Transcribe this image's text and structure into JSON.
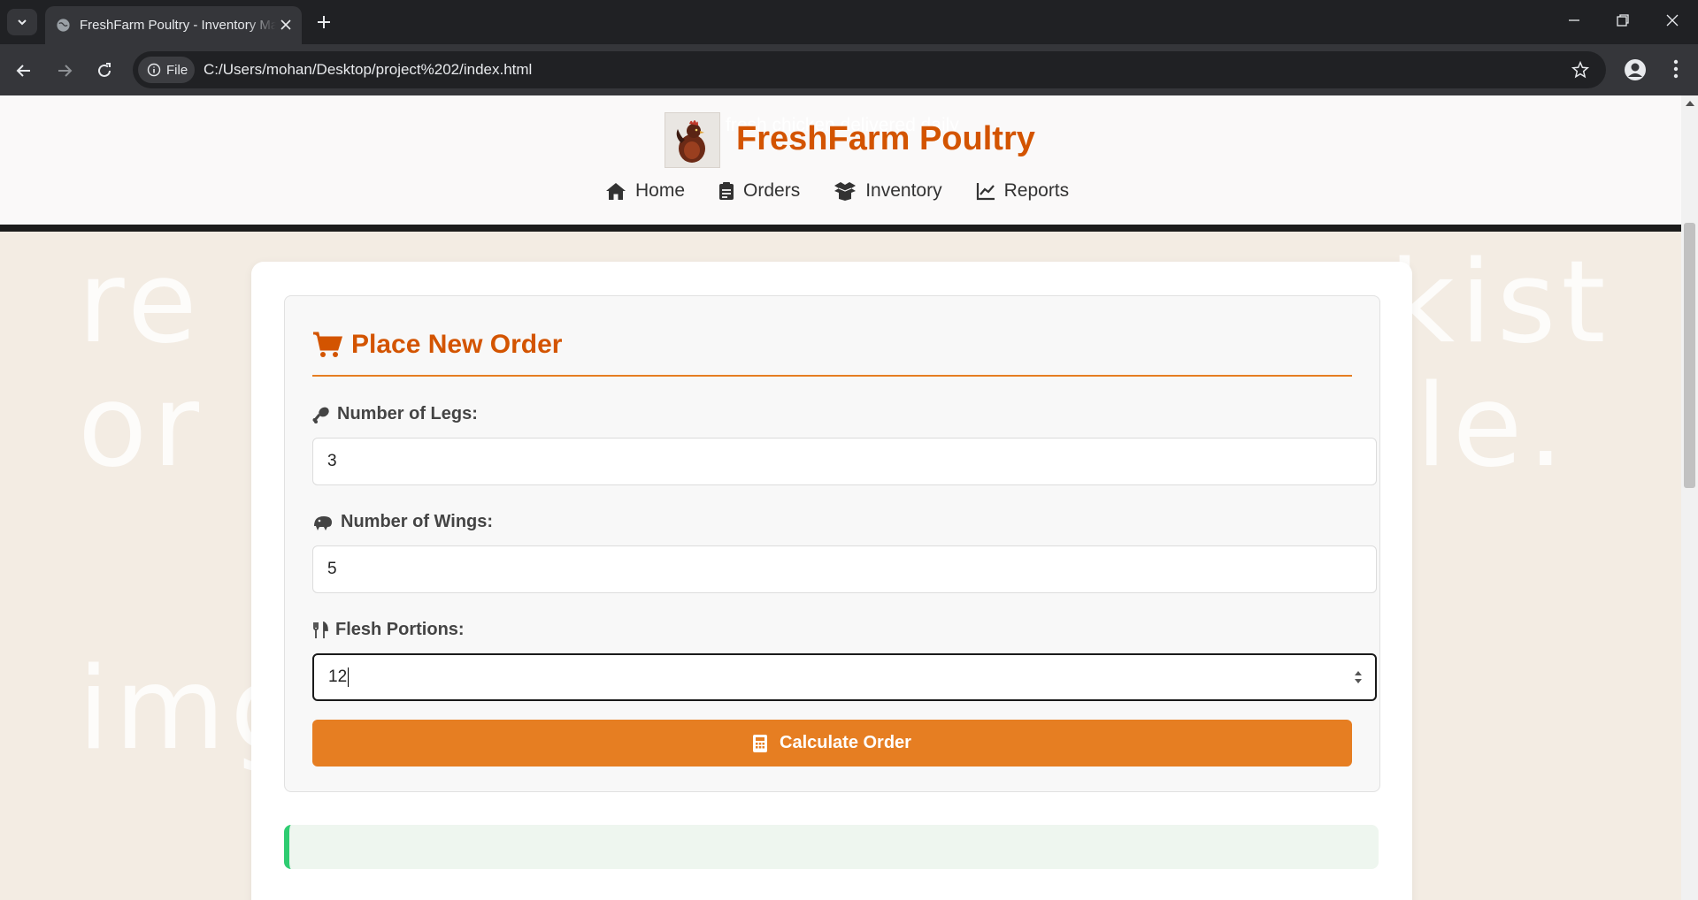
{
  "browser": {
    "tab_title": "FreshFarm Poultry - Inventory Management",
    "url": "C:/Users/mohan/Desktop/project%202/index.html",
    "site_chip_label": "File"
  },
  "page": {
    "background_words": [
      "re",
      "kist",
      "or",
      "le.",
      "img"
    ],
    "tagline": "fresh chicken delivered daily",
    "brand": "FreshFarm Poultry",
    "nav": [
      {
        "label": "Home",
        "icon": "home-icon"
      },
      {
        "label": "Orders",
        "icon": "clipboard-icon"
      },
      {
        "label": "Inventory",
        "icon": "box-icon"
      },
      {
        "label": "Reports",
        "icon": "chart-line-icon"
      }
    ],
    "form": {
      "title": "Place New Order",
      "fields": [
        {
          "label": "Number of Legs:",
          "value": "3",
          "icon": "drumstick-icon"
        },
        {
          "label": "Number of Wings:",
          "value": "5",
          "icon": "wing-icon"
        },
        {
          "label": "Flesh Portions:",
          "value": "12",
          "icon": "utensils-icon"
        }
      ],
      "submit_label": "Calculate Order"
    },
    "colors": {
      "brand": "#d35400",
      "accent": "#e67e22",
      "success": "#2ecc71"
    }
  }
}
